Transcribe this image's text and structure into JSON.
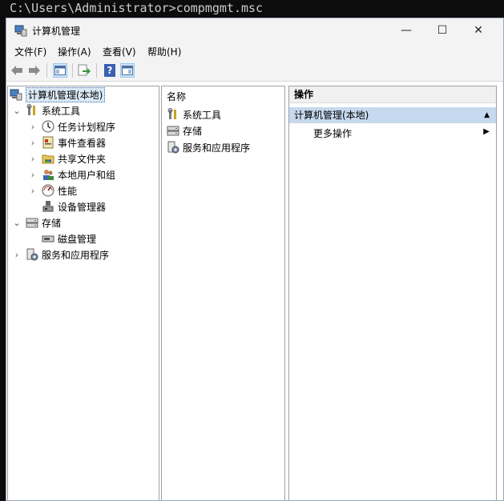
{
  "console": {
    "command": "C:\\Users\\Administrator>compmgmt.msc"
  },
  "window": {
    "title": "计算机管理",
    "controls": {
      "minimize": "—",
      "maximize": "☐",
      "close": "✕"
    }
  },
  "menu": [
    "文件(F)",
    "操作(A)",
    "查看(V)",
    "帮助(H)"
  ],
  "toolbar_icons": [
    "back-arrow-icon",
    "forward-arrow-icon",
    "show-hide-console-tree-icon",
    "export-list-icon",
    "help-icon",
    "action-pane-icon"
  ],
  "tree": {
    "root": "计算机管理(本地)",
    "items": [
      {
        "label": "系统工具",
        "icon": "tools-icon",
        "expanded": true
      },
      {
        "label": "任务计划程序",
        "icon": "clock-icon"
      },
      {
        "label": "事件查看器",
        "icon": "event-viewer-icon"
      },
      {
        "label": "共享文件夹",
        "icon": "shared-folder-icon"
      },
      {
        "label": "本地用户和组",
        "icon": "users-icon"
      },
      {
        "label": "性能",
        "icon": "performance-icon"
      },
      {
        "label": "设备管理器",
        "icon": "device-manager-icon"
      },
      {
        "label": "存储",
        "icon": "storage-icon",
        "expanded": true
      },
      {
        "label": "磁盘管理",
        "icon": "disk-icon"
      },
      {
        "label": "服务和应用程序",
        "icon": "services-icon"
      }
    ]
  },
  "list": {
    "header": "名称",
    "rows": [
      "系统工具",
      "存储",
      "服务和应用程序"
    ]
  },
  "actions": {
    "header": "操作",
    "section": "计算机管理(本地)",
    "more": "更多操作"
  },
  "colors": {
    "accent": "#c6d9ee",
    "selection": "#dbe8f5"
  }
}
